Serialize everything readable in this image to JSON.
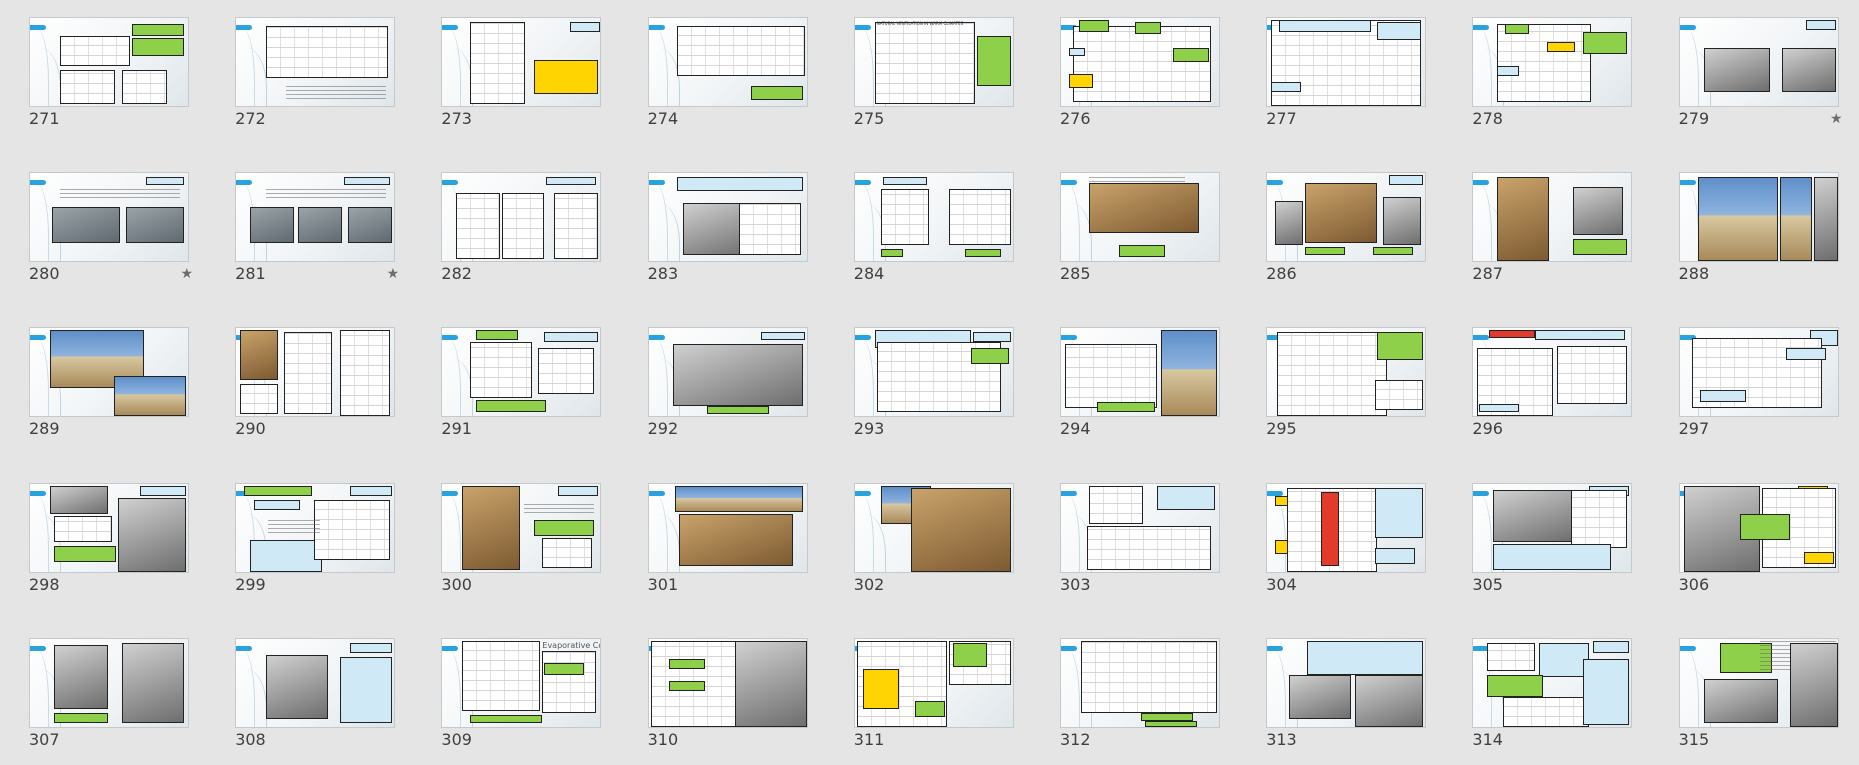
{
  "view": "slide-sorter",
  "slides": [
    {
      "number": "271",
      "starred": false,
      "layout": "sketch-two-green"
    },
    {
      "number": "272",
      "starred": false,
      "layout": "sketch-bottom-text"
    },
    {
      "number": "273",
      "starred": false,
      "layout": "sketch-left-blue-right"
    },
    {
      "number": "274",
      "starred": false,
      "layout": "sketch-wide-green"
    },
    {
      "number": "275",
      "starred": false,
      "layout": "grid-four-blue"
    },
    {
      "number": "276",
      "starred": false,
      "layout": "section-colored-labels"
    },
    {
      "number": "277",
      "starred": false,
      "layout": "section-diagram-text"
    },
    {
      "number": "278",
      "starred": false,
      "layout": "diagram-yellow-red"
    },
    {
      "number": "279",
      "starred": true,
      "layout": "two-photos-text"
    },
    {
      "number": "280",
      "starred": true,
      "layout": "two-gray-text"
    },
    {
      "number": "281",
      "starred": true,
      "layout": "three-gray-text"
    },
    {
      "number": "282",
      "starred": false,
      "layout": "four-sketches"
    },
    {
      "number": "283",
      "starred": false,
      "layout": "sketch-dark"
    },
    {
      "number": "284",
      "starred": false,
      "layout": "two-sketch-green"
    },
    {
      "number": "285",
      "starred": false,
      "layout": "photo-center-green"
    },
    {
      "number": "286",
      "starred": false,
      "layout": "three-photos-green"
    },
    {
      "number": "287",
      "starred": false,
      "layout": "two-photos-label"
    },
    {
      "number": "288",
      "starred": false,
      "layout": "two-photos-wide"
    },
    {
      "number": "289",
      "starred": false,
      "layout": "two-photos-diag"
    },
    {
      "number": "290",
      "starred": false,
      "layout": "plans-three"
    },
    {
      "number": "291",
      "starred": false,
      "layout": "sketch-green-right"
    },
    {
      "number": "292",
      "starred": false,
      "layout": "big-gray-sketch"
    },
    {
      "number": "293",
      "starred": false,
      "layout": "facade-sketch"
    },
    {
      "number": "294",
      "starred": false,
      "layout": "section-photo-right"
    },
    {
      "number": "295",
      "starred": false,
      "layout": "section-green-pink"
    },
    {
      "number": "296",
      "starred": false,
      "layout": "sketch-red-tag"
    },
    {
      "number": "297",
      "starred": false,
      "layout": "section-arrows"
    },
    {
      "number": "298",
      "starred": false,
      "layout": "photo-grid-right"
    },
    {
      "number": "299",
      "starred": false,
      "layout": "text-blue-sketch"
    },
    {
      "number": "300",
      "starred": false,
      "layout": "photo-green-sketch"
    },
    {
      "number": "301",
      "starred": false,
      "layout": "two-panoramas"
    },
    {
      "number": "302",
      "starred": false,
      "layout": "photos-chimneys"
    },
    {
      "number": "303",
      "starred": false,
      "layout": "sketch-blue-box"
    },
    {
      "number": "304",
      "starred": false,
      "layout": "red-tower"
    },
    {
      "number": "305",
      "starred": false,
      "layout": "gray-detail-green"
    },
    {
      "number": "306",
      "starred": false,
      "layout": "bw-photo-sketch"
    },
    {
      "number": "307",
      "starred": false,
      "layout": "two-bw-photos"
    },
    {
      "number": "308",
      "starred": false,
      "layout": "gray-sketch-blue"
    },
    {
      "number": "309",
      "starred": false,
      "layout": "evaporative-cooling"
    },
    {
      "number": "310",
      "starred": false,
      "layout": "book-page-photo"
    },
    {
      "number": "311",
      "starred": false,
      "layout": "colored-diagram"
    },
    {
      "number": "312",
      "starred": false,
      "layout": "plan-sketch"
    },
    {
      "number": "313",
      "starred": false,
      "layout": "two-photos-text-top"
    },
    {
      "number": "314",
      "starred": false,
      "layout": "sketch-blue-right"
    },
    {
      "number": "315",
      "starred": false,
      "layout": "bw-building-photos"
    }
  ],
  "thumb_text": {
    "evaporative": "Evaporative Cooling",
    "natural": "NATURAL VENTILATION IN WARM CLIMATES"
  },
  "icons": {
    "star": "★"
  },
  "colors": {
    "background": "#e5e5e5",
    "accent_tab": "#29a3e0",
    "label_green": "#8fd04a",
    "label_blue": "#cfe9f7",
    "label_yellow": "#ffd400",
    "number_text": "#404040"
  }
}
